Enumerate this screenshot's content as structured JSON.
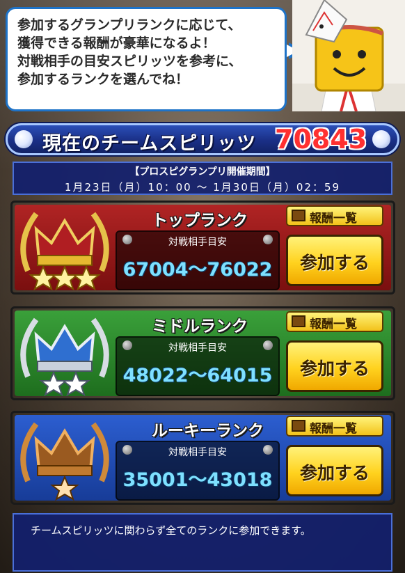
{
  "bubble": {
    "lines": [
      "参加するグランプリランクに応じて、",
      "獲得できる報酬が豪華になるよ！",
      "対戦相手の目安スピリッツを参考に、",
      "参加するランクを選んでね！"
    ]
  },
  "spirits": {
    "label": "現在のチームスピリッツ",
    "value": "70843"
  },
  "period": {
    "title": "【プロスピグランプリ開催期間】",
    "range": "1月23日（月）10：00 ～ 1月30日（月）02：59"
  },
  "ranks": [
    {
      "title": "トップランク",
      "reward_label": "報酬一覧",
      "opponent_label": "対戦相手目安",
      "opponent_range": "67004～76022",
      "join_label": "参加する",
      "stars": 3,
      "crown_color": "#c0262b"
    },
    {
      "title": "ミドルランク",
      "reward_label": "報酬一覧",
      "opponent_label": "対戦相手目安",
      "opponent_range": "48022～64015",
      "join_label": "参加する",
      "stars": 2,
      "crown_color": "#2f6fd0"
    },
    {
      "title": "ルーキーランク",
      "reward_label": "報酬一覧",
      "opponent_label": "対戦相手目安",
      "opponent_range": "35001～43018",
      "join_label": "参加する",
      "stars": 1,
      "crown_color": "#9a5a20"
    }
  ],
  "note": {
    "text": "チームスピリッツに関わらず全てのランクに参加できます。"
  },
  "colors": {
    "spirits_value": "#ff3030",
    "top_panel": "#b02424",
    "middle_panel": "#3aa03a",
    "rookie_panel": "#2c5ed0",
    "button_yellow": "#ffd21e"
  }
}
